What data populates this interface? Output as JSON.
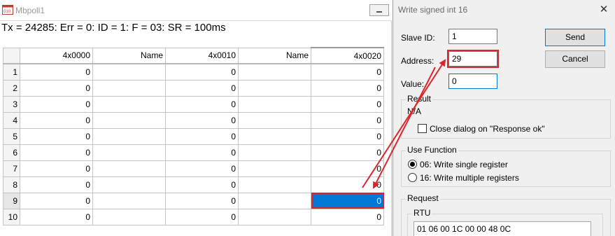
{
  "mbpoll": {
    "title": "Mbpoll1",
    "status": "Tx = 24285: Err = 0: ID = 1: F = 03: SR = 100ms",
    "columns": [
      "",
      "4x0000",
      "Name",
      "4x0010",
      "Name",
      "4x0020"
    ],
    "rows": [
      {
        "n": "1",
        "c1": "0",
        "c2": "",
        "c3": "0",
        "c4": "",
        "c5": "0"
      },
      {
        "n": "2",
        "c1": "0",
        "c2": "",
        "c3": "0",
        "c4": "",
        "c5": "0"
      },
      {
        "n": "3",
        "c1": "0",
        "c2": "",
        "c3": "0",
        "c4": "",
        "c5": "0"
      },
      {
        "n": "4",
        "c1": "0",
        "c2": "",
        "c3": "0",
        "c4": "",
        "c5": "0"
      },
      {
        "n": "5",
        "c1": "0",
        "c2": "",
        "c3": "0",
        "c4": "",
        "c5": "0"
      },
      {
        "n": "6",
        "c1": "0",
        "c2": "",
        "c3": "0",
        "c4": "",
        "c5": "0"
      },
      {
        "n": "7",
        "c1": "0",
        "c2": "",
        "c3": "0",
        "c4": "",
        "c5": "0"
      },
      {
        "n": "8",
        "c1": "0",
        "c2": "",
        "c3": "0",
        "c4": "",
        "c5": "0"
      },
      {
        "n": "9",
        "c1": "0",
        "c2": "",
        "c3": "0",
        "c4": "",
        "c5": "0"
      },
      {
        "n": "10",
        "c1": "0",
        "c2": "",
        "c3": "0",
        "c4": "",
        "c5": "0"
      }
    ],
    "selected_row": "9",
    "selected_column": "4x0020"
  },
  "dialog": {
    "title": "Write signed int 16",
    "slave_id_label": "Slave ID:",
    "slave_id_value": "1",
    "address_label": "Address:",
    "address_value": "29",
    "value_label": "Value:",
    "value_value": "0",
    "send_label": "Send",
    "cancel_label": "Cancel",
    "result": {
      "title": "Result",
      "text": "N/A",
      "close_on_ok_label": "Close dialog on \"Response ok\"",
      "close_on_ok_checked": false
    },
    "use_function": {
      "title": "Use Function",
      "options": [
        "06: Write single register",
        "16: Write multiple registers"
      ],
      "selected": "06: Write single register"
    },
    "request": {
      "title": "Request",
      "rtu_label": "RTU",
      "rtu_bytes": "01 06 00 1C 00 00 48 0C"
    }
  },
  "colors": {
    "selection": "#0078d7",
    "annotation": "#d9252b",
    "dialog_bg": "#f0f0f0"
  }
}
